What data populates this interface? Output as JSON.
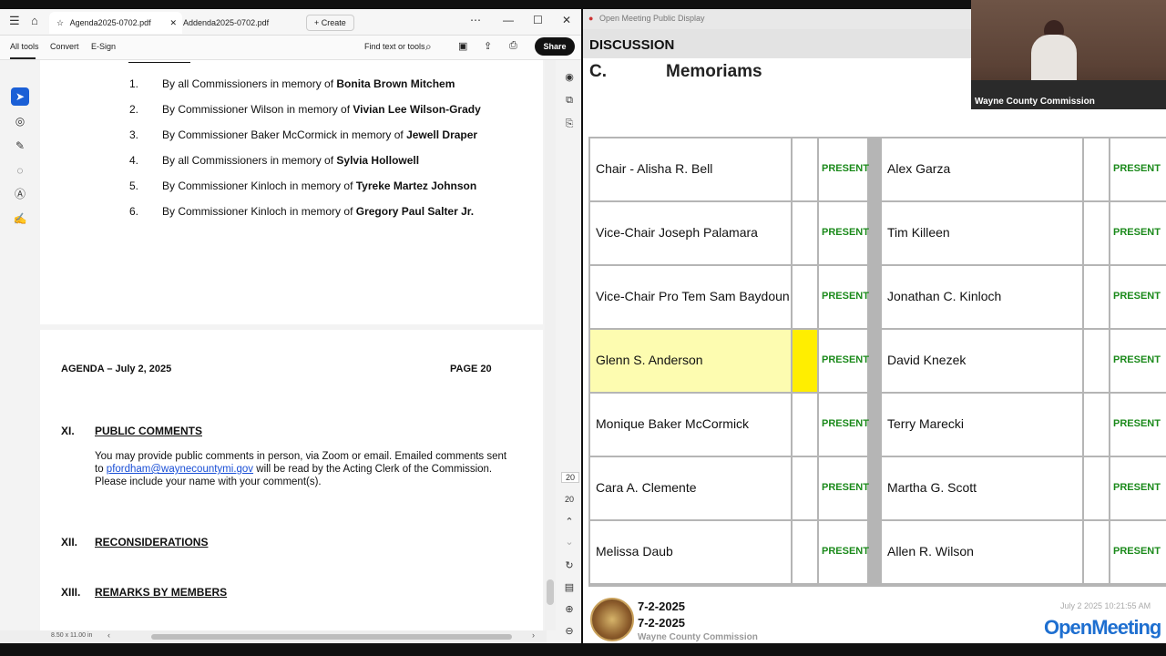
{
  "pdf": {
    "tabs": [
      {
        "label": "Agenda2025-0702.pdf"
      },
      {
        "label": "Addenda2025-0702.pdf"
      }
    ],
    "create_label": "Create",
    "toolbar": {
      "all_tools": "All tools",
      "convert": "Convert",
      "esign": "E-Sign",
      "find": "Find text or tools",
      "share": "Share"
    },
    "memorials": [
      {
        "num": "1.",
        "prefix": "By all Commissioners in memory of ",
        "name": "Bonita Brown Mitchem"
      },
      {
        "num": "2.",
        "prefix": "By Commissioner Wilson in memory of ",
        "name": "Vivian Lee Wilson-Grady"
      },
      {
        "num": "3.",
        "prefix": "By Commissioner Baker McCormick in memory of ",
        "name": "Jewell Draper"
      },
      {
        "num": "4.",
        "prefix": "By all Commissioners in memory of ",
        "name": "Sylvia Hollowell"
      },
      {
        "num": "5.",
        "prefix": "By Commissioner Kinloch in memory of ",
        "name": "Tyreke Martez Johnson"
      },
      {
        "num": "6.",
        "prefix": "By Commissioner Kinloch in memory of ",
        "name": "Gregory Paul Salter Jr."
      }
    ],
    "page2": {
      "header_left": "AGENDA – July 2, 2025",
      "header_right": "PAGE 20",
      "sections": [
        {
          "num": "XI.",
          "title": "PUBLIC COMMENTS"
        },
        {
          "num": "XII.",
          "title": "RECONSIDERATIONS"
        },
        {
          "num": "XIII.",
          "title": "REMARKS BY MEMBERS"
        }
      ],
      "public_comments": {
        "line1": "You may provide public comments in person, via Zoom or email. Emailed comments sent",
        "to": "to",
        "email": "pfordham@waynecountymi.gov",
        "line2_rest": " will be read by the Acting Clerk of the Commission.",
        "line3": "Please include your name with your comment(s)."
      }
    },
    "page_numbers": [
      "20",
      "20"
    ],
    "page_size": "8.50 x 11.00 in"
  },
  "display": {
    "window_title": "Open Meeting Public Display",
    "heading": "DISCUSSION",
    "section_letter": "C.",
    "section_title": "Memoriams",
    "status_label": "PRESENT",
    "left_column": [
      {
        "name": "Chair - Alisha R. Bell",
        "status": "PRESENT",
        "highlight": false
      },
      {
        "name": "Vice-Chair Joseph Palamara",
        "status": "PRESENT",
        "highlight": false
      },
      {
        "name": "Vice-Chair Pro Tem Sam Baydoun",
        "status": "PRESENT",
        "highlight": false
      },
      {
        "name": "Glenn S. Anderson",
        "status": "PRESENT",
        "highlight": true
      },
      {
        "name": "Monique Baker McCormick",
        "status": "PRESENT",
        "highlight": false
      },
      {
        "name": "Cara A. Clemente",
        "status": "PRESENT",
        "highlight": false
      },
      {
        "name": "Melissa Daub",
        "status": "PRESENT",
        "highlight": false
      }
    ],
    "right_column": [
      {
        "name": "Alex Garza",
        "status": "PRESENT"
      },
      {
        "name": "Tim Killeen",
        "status": "PRESENT"
      },
      {
        "name": "Jonathan C. Kinloch",
        "status": "PRESENT"
      },
      {
        "name": "David Knezek",
        "status": "PRESENT"
      },
      {
        "name": "Terry Marecki",
        "status": "PRESENT"
      },
      {
        "name": "Martha G. Scott",
        "status": "PRESENT"
      },
      {
        "name": "Allen R. Wilson",
        "status": "PRESENT"
      }
    ],
    "footer": {
      "date1": "7-2-2025",
      "date2": "7-2-2025",
      "org": "Wayne County Commission",
      "timestamp": "July 2 2025 10:21:55 AM",
      "logo": "OpenMeeting"
    },
    "colors": {
      "present": "#1b8a1b",
      "highlight": "#fdfcb0",
      "marker": "#ffee00"
    }
  },
  "video": {
    "label": "Wayne County Commission"
  }
}
